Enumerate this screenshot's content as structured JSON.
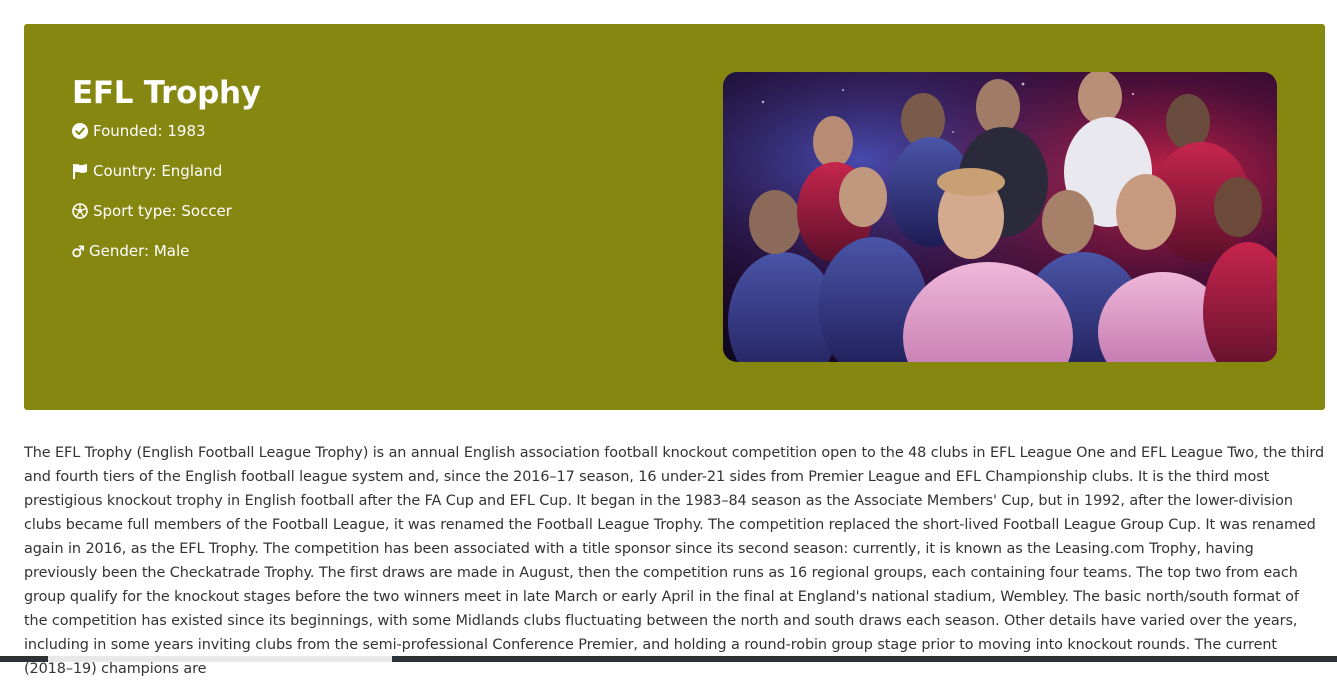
{
  "competition": {
    "title": "EFL Trophy",
    "founded_label": "Founded: 1983",
    "country_label": "Country: England",
    "sport_label": "Sport type: Soccer",
    "gender_label": "Gender: Male",
    "icons": {
      "founded": "check-circle-icon",
      "country": "flag-icon",
      "sport": "soccer-ball-icon",
      "gender": "male-icon"
    }
  },
  "hero_image": {
    "description_text_visible": "",
    "brand_colors": [
      "#868711"
    ]
  },
  "description": "The EFL Trophy (English Football League Trophy) is an annual English association football knockout competition open to the 48 clubs in EFL League One and EFL League Two, the third and fourth tiers of the English football league system and, since the 2016–17 season, 16 under-21 sides from Premier League and EFL Championship clubs. It is the third most prestigious knockout trophy in English football after the FA Cup and EFL Cup. It began in the 1983–84 season as the Associate Members' Cup, but in 1992, after the lower-division clubs became full members of the Football League, it was renamed the Football League Trophy. The competition replaced the short-lived Football League Group Cup. It was renamed again in 2016, as the EFL Trophy. The competition has been associated with a title sponsor since its second season: currently, it is known as the Leasing.com Trophy, having previously been the Checkatrade Trophy. The first draws are made in August, then the competition runs as 16 regional groups, each containing four teams. The top two from each group qualify for the knockout stages before the two winners meet in late March or early April in the final at England's national stadium, Wembley. The basic north/south format of the competition has existed since its beginnings, with some Midlands clubs fluctuating between the north and south draws each season. Other details have varied over the years, including in some years inviting clubs from the semi-professional Conference Premier, and holding a round-robin group stage prior to moving into knockout rounds. The current (2018–19) champions are",
  "scrollbar": {
    "position_fraction": 0.036
  }
}
